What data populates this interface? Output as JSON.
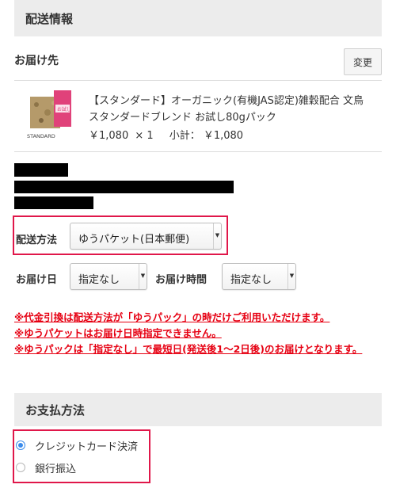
{
  "shipping_section": {
    "title": "配送情報"
  },
  "recipient": {
    "title": "お届け先",
    "change_label": "変更"
  },
  "product": {
    "image_tag_text": "お試し",
    "brand_text": "STANDARD",
    "title": "【スタンダード】オーガニック(有機JAS認定)雑穀配合 文鳥スタンダードブレンド お試し80gパック",
    "unit_price": "￥1,080",
    "quantity": "× 1",
    "subtotal_label": "小計：",
    "subtotal": "￥1,080"
  },
  "shipping_method": {
    "label": "配送方法",
    "selected": "ゆうパケット(日本郵便)"
  },
  "delivery_date": {
    "label": "お届け日",
    "selected": "指定なし"
  },
  "delivery_time": {
    "label": "お届け時間",
    "selected": "指定なし"
  },
  "notices": [
    "※代金引換は配送方法が「ゆうパック」の時だけご利用いただけます。",
    "※ゆうパケットはお届け日時指定できません。",
    "※ゆうパックは「指定なし」で最短日(発送後1〜2日後)のお届けとなります。"
  ],
  "payment_section": {
    "title": "お支払方法"
  },
  "payment_options": [
    {
      "label": "クレジットカード決済",
      "checked": true
    },
    {
      "label": "銀行振込",
      "checked": false
    }
  ],
  "colors": {
    "highlight": "#e0174a",
    "notice": "#e60012",
    "radio_accent": "#3b8beb",
    "header_bg": "#ececec"
  }
}
